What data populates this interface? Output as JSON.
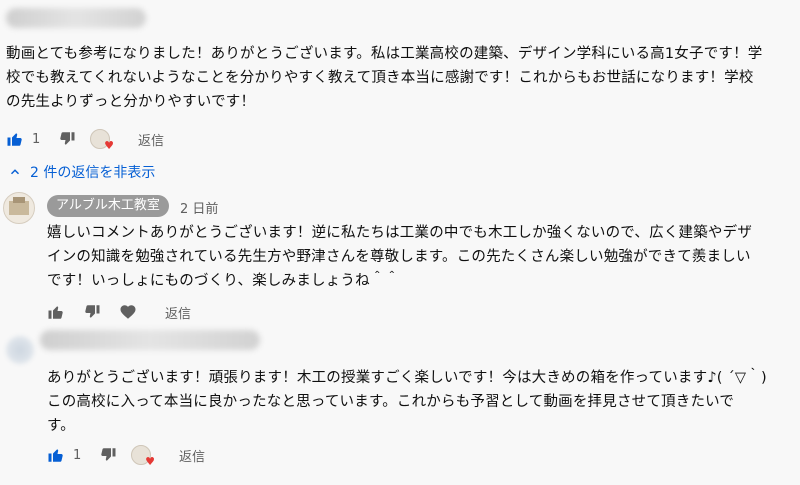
{
  "comments": [
    {
      "text": "動画とても参考になりました！ありがとうございます。私は工業高校の建築、デザイン学科にいる高1女子です！学\n校でも教えてくれないようなことを分かりやすく教えて頂き本当に感謝です！これからもお世話になります！学校\nの先生よりずっと分かりやすいです！",
      "likes": "1",
      "reply_label": "返信"
    }
  ],
  "replies_toggle": {
    "label": "2 件の返信を非表示"
  },
  "replies": [
    {
      "author": "アルブル木工教室",
      "time": "2 日前",
      "text": "嬉しいコメントありがとうございます！逆に私たちは工業の中でも木工しか強くないので、広く建築やデザ\nインの知識を勉強されている先生方や野津さんを尊敬します。この先たくさん楽しい勉強ができて羨ましい\nです！いっしょにものづくり、楽しみましょうね＾＾",
      "reply_label": "返信"
    },
    {
      "text": "ありがとうございます！頑張ります！木工の授業すごく楽しいです！今は大きめの箱を作っています♪( ´▽｀)\nこの高校に入って本当に良かったなと思っています。これからも予習として動画を拝見させて頂きたいで\nす。",
      "likes": "1",
      "reply_label": "返信"
    }
  ],
  "colors": {
    "link": "#065fd4",
    "badge": "#9a9a9a",
    "heart": "#e53935",
    "like_active": "#065fd4"
  },
  "icons": [
    "thumbs-up-icon",
    "thumbs-down-icon",
    "creator-heart-icon",
    "chevron-up-icon",
    "heart-icon"
  ]
}
